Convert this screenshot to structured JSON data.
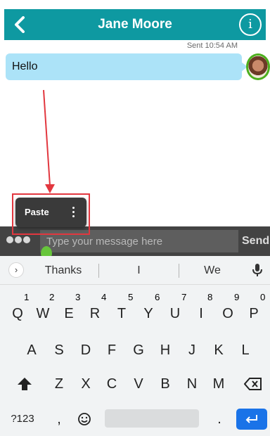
{
  "header": {
    "title": "Jane Moore"
  },
  "chat": {
    "sent_label": "Sent 10:54 AM",
    "messages": [
      {
        "text": "Hello"
      }
    ]
  },
  "context_menu": {
    "paste_label": "Paste"
  },
  "input": {
    "placeholder": "Type your message here",
    "send_label": "Send"
  },
  "keyboard": {
    "suggestions": [
      "Thanks",
      "I",
      "We"
    ],
    "row1": [
      {
        "k": "Q",
        "n": "1"
      },
      {
        "k": "W",
        "n": "2"
      },
      {
        "k": "E",
        "n": "3"
      },
      {
        "k": "R",
        "n": "4"
      },
      {
        "k": "T",
        "n": "5"
      },
      {
        "k": "Y",
        "n": "6"
      },
      {
        "k": "U",
        "n": "7"
      },
      {
        "k": "I",
        "n": "8"
      },
      {
        "k": "O",
        "n": "9"
      },
      {
        "k": "P",
        "n": "0"
      }
    ],
    "row2": [
      "A",
      "S",
      "D",
      "F",
      "G",
      "H",
      "J",
      "K",
      "L"
    ],
    "row3": [
      "Z",
      "X",
      "C",
      "V",
      "B",
      "N",
      "M"
    ],
    "symbols_label": "?123",
    "comma": ",",
    "period": "."
  },
  "colors": {
    "header": "#0e99a1",
    "bubble": "#ace3f8",
    "annotation": "#e2373f",
    "enter": "#1a73e8"
  },
  "icons": [
    "back-arrow-icon",
    "info-icon",
    "more-vert-icon",
    "dots-icon",
    "chevron-right-icon",
    "mic-icon",
    "shift-icon",
    "backspace-icon",
    "emoji-icon",
    "enter-icon"
  ]
}
